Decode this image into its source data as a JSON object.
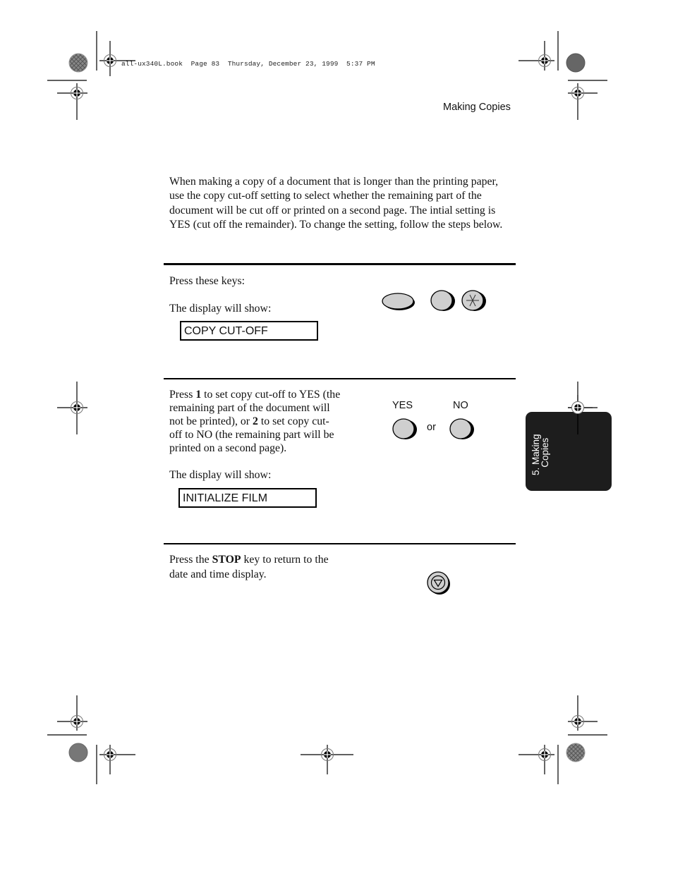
{
  "book_header": "all-ux340L.book  Page 83  Thursday, December 23, 1999  5:37 PM",
  "running_head": "Making Copies",
  "intro": "When making a copy of a document that is longer than the printing paper, use the copy cut-off setting to select whether the remaining part of the document will be cut off or printed on a second page. The intial setting is YES (cut off the remainder). To change the setting, follow the steps below.",
  "steps": [
    {
      "instruction": "Press these keys:",
      "display_label": "The display will show:",
      "display_value": "COPY CUT-OFF",
      "keys": [
        "function-key",
        "number-key",
        "star-key"
      ]
    },
    {
      "instruction_parts": {
        "l1a": "Press ",
        "l1b": "1",
        "l1c": " to set copy cut-off to YES (the",
        "l2": "remaining part of the document will",
        "l3a": "not be printed), or ",
        "l3b": "2",
        "l3c": " to set copy cut-",
        "l4": "off to NO (the remaining part will be",
        "l5": "printed on a second page)."
      },
      "display_label": "The display will show:",
      "display_value": "INITIALIZE FILM",
      "yes_label": "YES",
      "or_label": "or",
      "no_label": "NO"
    },
    {
      "instruction_parts": {
        "l1a": "Press the ",
        "l1b": "STOP",
        "l1c": " key to return to the",
        "l2": "date and time display."
      },
      "key": "stop-key"
    }
  ],
  "side_tab": {
    "line1": "5. Making",
    "line2": "   Copies",
    "color": "#1d1d1d"
  }
}
